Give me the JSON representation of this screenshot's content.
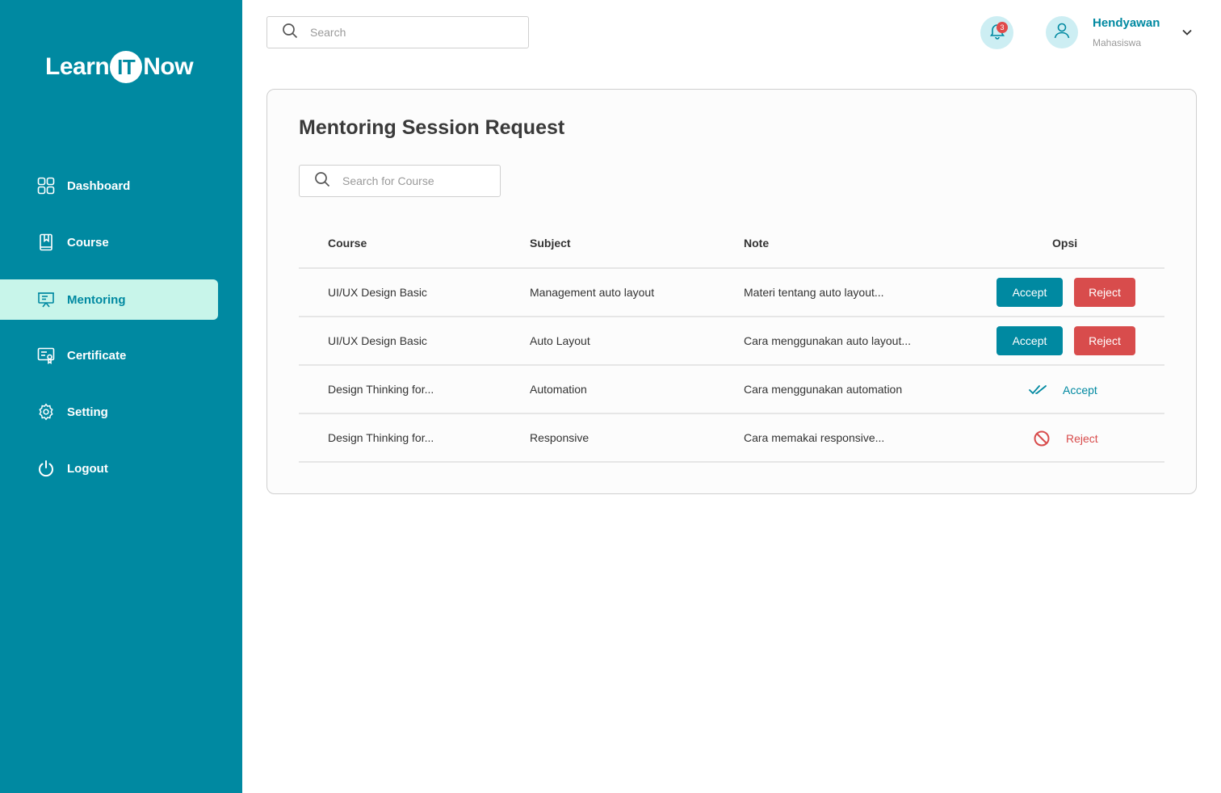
{
  "app": {
    "logo_pre": "Learn",
    "logo_mid": "IT",
    "logo_post": "Now"
  },
  "colors": {
    "brand": "#0089a1",
    "active_bg": "#c8f5ea",
    "danger": "#d84c4c"
  },
  "sidebar": {
    "items": [
      {
        "label": "Dashboard",
        "icon": "grid-icon",
        "active": false
      },
      {
        "label": "Course",
        "icon": "book-icon",
        "active": false
      },
      {
        "label": "Mentoring",
        "icon": "presentation-icon",
        "active": true
      },
      {
        "label": "Certificate",
        "icon": "certificate-icon",
        "active": false
      },
      {
        "label": "Setting",
        "icon": "gear-icon",
        "active": false
      },
      {
        "label": "Logout",
        "icon": "power-icon",
        "active": false
      }
    ]
  },
  "header": {
    "search_placeholder": "Search",
    "notification_count": "3",
    "user_name": "Hendyawan",
    "user_role": "Mahasiswa"
  },
  "main": {
    "title": "Mentoring Session Request",
    "course_search_placeholder": "Search for Course",
    "columns": [
      "Course",
      "Subject",
      "Note",
      "Opsi"
    ],
    "rows": [
      {
        "course": "UI/UX Design Basic",
        "subject": "Management auto layout",
        "note": "Materi tentang auto layout...",
        "status": "pending",
        "accept_label": "Accept",
        "reject_label": "Reject"
      },
      {
        "course": "UI/UX Design Basic",
        "subject": "Auto Layout",
        "note": "Cara menggunakan auto layout...",
        "status": "pending",
        "accept_label": "Accept",
        "reject_label": "Reject"
      },
      {
        "course": "Design Thinking for...",
        "subject": "Automation",
        "note": "Cara menggunakan automation",
        "status": "accepted",
        "status_label": "Accept"
      },
      {
        "course": "Design Thinking for...",
        "subject": "Responsive",
        "note": "Cara memakai responsive...",
        "status": "rejected",
        "status_label": "Reject"
      }
    ]
  }
}
